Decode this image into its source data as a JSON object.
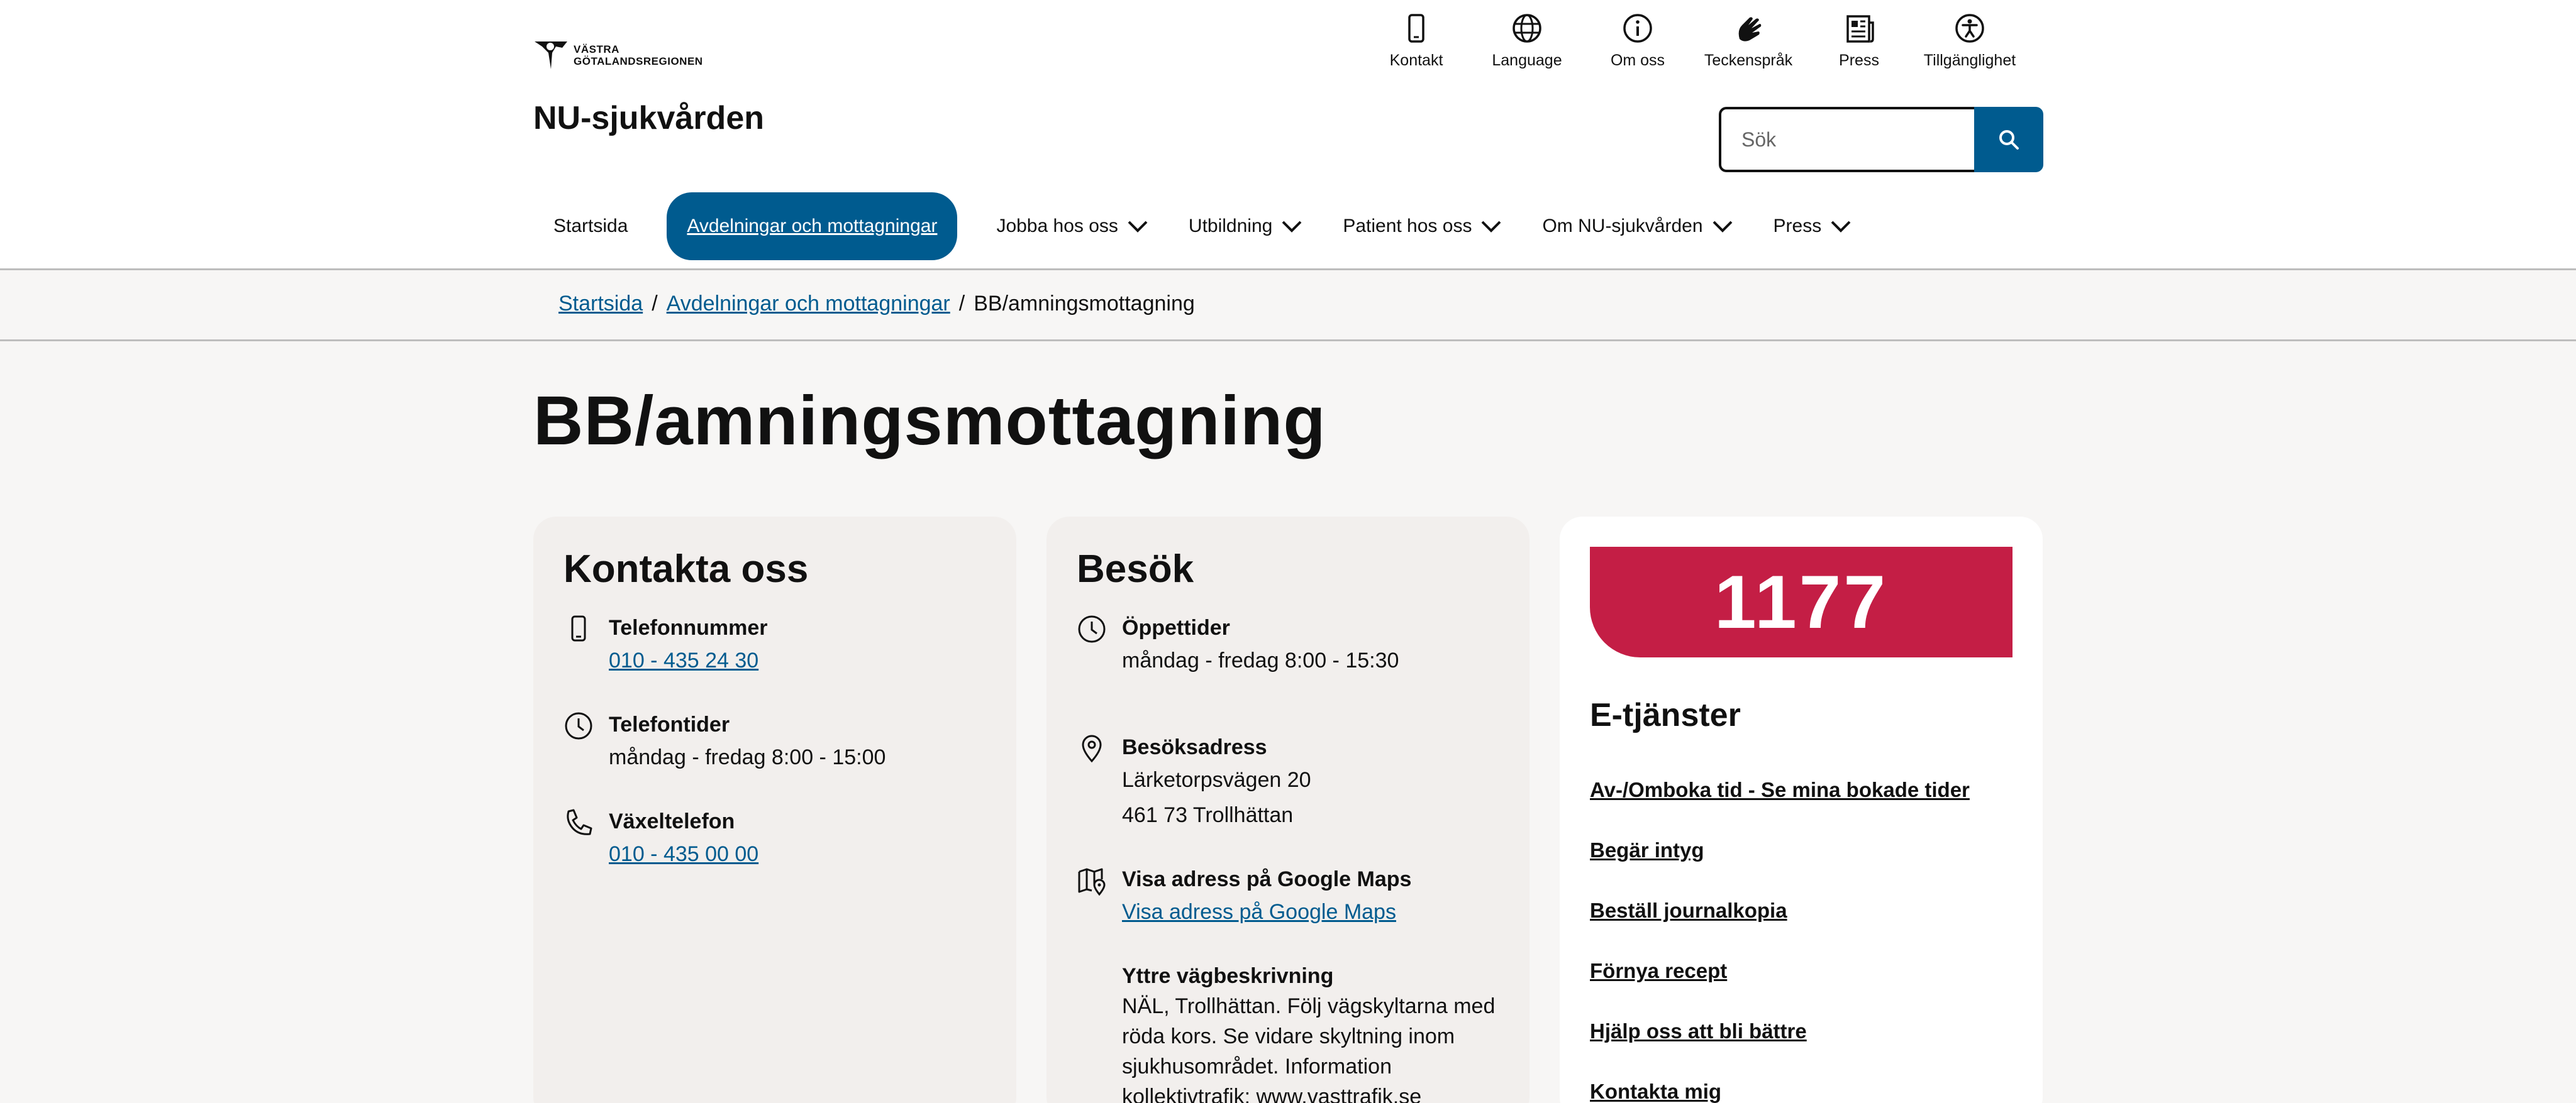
{
  "logo": {
    "line1": "VÄSTRA",
    "line2": "GÖTALANDSREGIONEN"
  },
  "site_title": "NU-sjukvården",
  "toplinks": [
    {
      "icon": "phone-icon",
      "label": "Kontakt"
    },
    {
      "icon": "globe-icon",
      "label": "Language"
    },
    {
      "icon": "info-icon",
      "label": "Om oss"
    },
    {
      "icon": "sign-language-icon",
      "label": "Teckenspråk"
    },
    {
      "icon": "newspaper-icon",
      "label": "Press"
    },
    {
      "icon": "accessibility-icon",
      "label": "Tillgänglighet"
    }
  ],
  "search": {
    "placeholder": "Sök"
  },
  "nav": [
    {
      "label": "Startsida"
    },
    {
      "label": "Avdelningar och mottagningar"
    },
    {
      "label": "Jobba hos oss"
    },
    {
      "label": "Utbildning"
    },
    {
      "label": "Patient hos oss"
    },
    {
      "label": "Om NU-sjukvården"
    },
    {
      "label": "Press"
    }
  ],
  "breadcrumb": {
    "home": "Startsida",
    "sep1": "/",
    "section": "Avdelningar och mottagningar",
    "sep2": "/",
    "current": "BB/amningsmottagning"
  },
  "page_title": "BB/amningsmottagning",
  "contact": {
    "title": "Kontakta oss",
    "phone_label": "Telefonnummer",
    "phone_value": "010 - 435 24 30",
    "hours_label": "Telefontider",
    "hours_value": "måndag - fredag 8:00 - 15:00",
    "switch_label": "Växeltelefon",
    "switch_value": "010 - 435 00 00"
  },
  "visit": {
    "title": "Besök",
    "open_label": "Öppettider",
    "open_value": "måndag - fredag 8:00 - 15:30",
    "addr_label": "Besöksadress",
    "addr_line1": "Lärketorpsvägen 20",
    "addr_line2": "461 73 Trollhättan",
    "maps_label": "Visa adress på Google Maps",
    "maps_link": "Visa adress på Google Maps",
    "dir_label": "Yttre vägbeskrivning",
    "dir_text": "NÄL, Trollhättan. Följ vägskyltarna med röda kors. Se vidare skyltning inom sjukhusområdet. Information kollektivtrafik: www.vasttrafik.se"
  },
  "eservices": {
    "logo_text": "1177",
    "title": "E-tjänster",
    "links": [
      "Av-/Omboka tid - Se mina bokade tider",
      "Begär intyg",
      "Beställ journalkopia",
      "Förnya recept",
      "Hjälp oss att bli bättre",
      "Kontakta mig"
    ]
  },
  "colors": {
    "brand_blue": "#005b8f",
    "brand_1177": "#c41e45"
  }
}
